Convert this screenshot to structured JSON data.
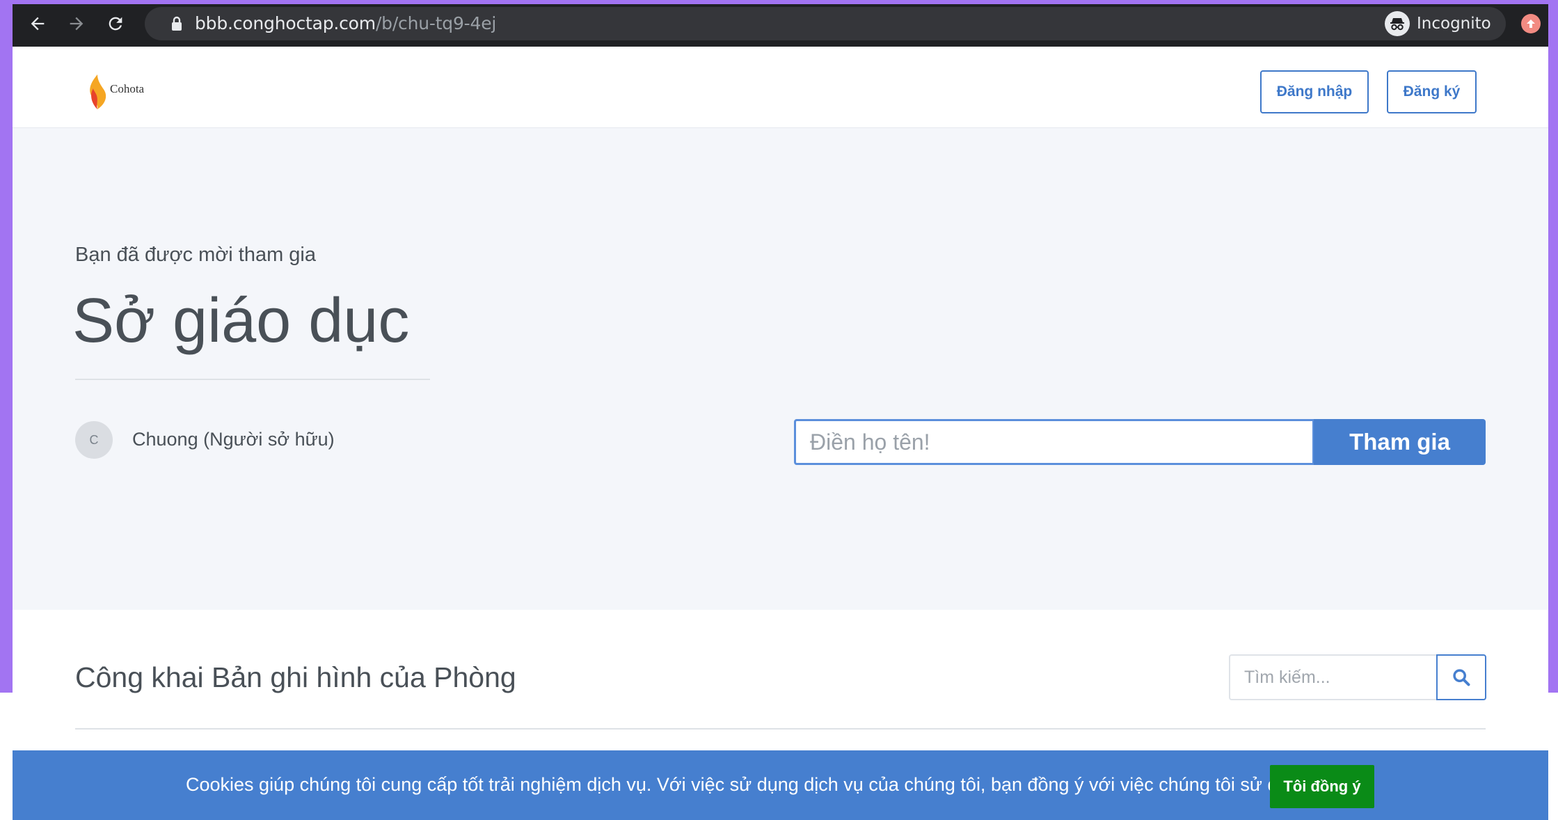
{
  "browser": {
    "url_host": "bbb.conghoctap.com",
    "url_path": "/b/chu-tq9-4ej",
    "profile_label": "Incognito",
    "icons": [
      "back-icon",
      "forward-icon",
      "reload-icon",
      "lock-icon",
      "star-icon",
      "incognito-icon",
      "update-icon"
    ]
  },
  "header": {
    "logo_text": "Cohota",
    "login_label": "Đăng nhập",
    "signup_label": "Đăng ký"
  },
  "hero": {
    "invite_text": "Bạn đã được mời tham gia",
    "room_name": "Sở giáo dục",
    "owner_initial": "C",
    "owner_name": "Chuong (Người sở hữu)",
    "name_placeholder": "Điền họ tên!",
    "join_label": "Tham gia"
  },
  "recordings": {
    "title": "Công khai Bản ghi hình của Phòng",
    "search_placeholder": "Tìm kiếm..."
  },
  "cookie": {
    "message": "Cookies giúp chúng tôi cung cấp tốt trải nghiệm dịch vụ. Với việc sử dụng dịch vụ của chúng tôi, bạn đồng ý với việc chúng tôi sử dụng cookie.",
    "agree_label": "Tôi đồng ý"
  },
  "colors": {
    "primary": "#467fcf",
    "agree_green": "#0a8b17",
    "hero_bg": "#f4f6fa",
    "text": "#495057",
    "frame_purple": "#a274f2"
  }
}
